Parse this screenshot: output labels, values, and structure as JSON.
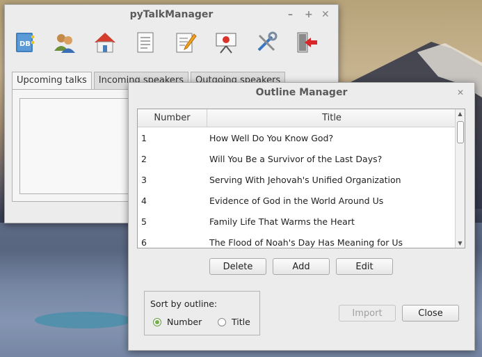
{
  "main_window": {
    "title": "pyTalkManager",
    "controls": [
      "–",
      "+",
      "✕"
    ],
    "toolbar": [
      {
        "name": "database-icon"
      },
      {
        "name": "people-icon"
      },
      {
        "name": "home-icon"
      },
      {
        "name": "document-icon"
      },
      {
        "name": "edit-document-icon"
      },
      {
        "name": "presentation-icon"
      },
      {
        "name": "tools-icon"
      },
      {
        "name": "exit-icon"
      }
    ],
    "tabs": [
      "Upcoming talks",
      "Incoming speakers",
      "Outgoing speakers"
    ]
  },
  "dialog": {
    "title": "Outline Manager",
    "close": "✕",
    "columns": [
      "Number",
      "Title"
    ],
    "rows": [
      {
        "number": "1",
        "title": "How Well Do You Know God?"
      },
      {
        "number": "2",
        "title": "Will You Be a Survivor of the Last Days?"
      },
      {
        "number": "3",
        "title": "Serving With Jehovah's Unified Organization"
      },
      {
        "number": "4",
        "title": "Evidence of God in the World Around Us"
      },
      {
        "number": "5",
        "title": "Family Life That Warms the Heart"
      },
      {
        "number": "6",
        "title": "The Flood of Noah's Day Has Meaning for Us"
      }
    ],
    "buttons": {
      "delete": "Delete",
      "add": "Add",
      "edit": "Edit",
      "import": "Import",
      "close": "Close"
    },
    "sort": {
      "label": "Sort by outline:",
      "option_number": "Number",
      "option_title": "Title",
      "selected": "Number"
    }
  }
}
